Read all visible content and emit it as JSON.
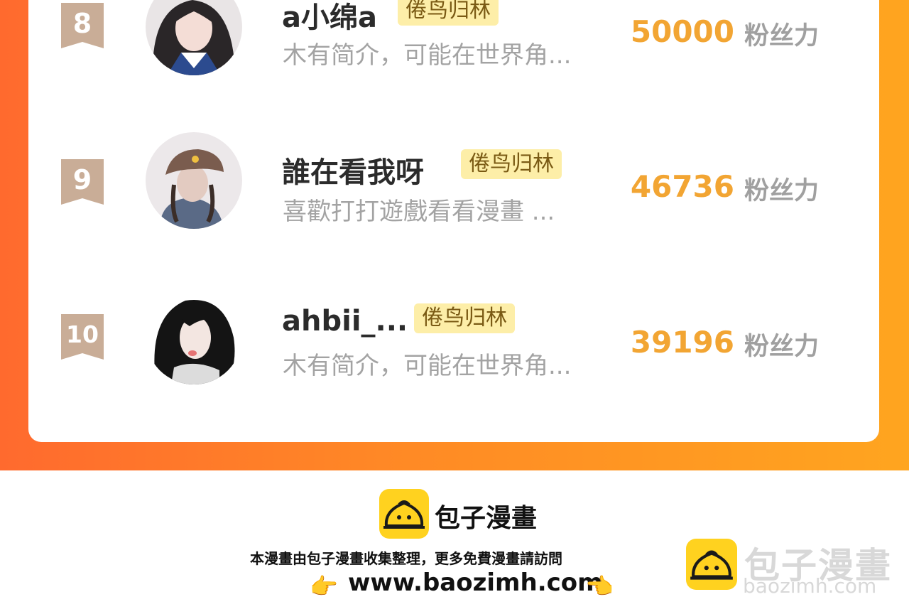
{
  "rows": [
    {
      "rank": "8",
      "name": "a小绵a",
      "tag": "倦鸟归林",
      "bio": "木有简介，可能在世界角...",
      "fans": "50000",
      "fans_label": "粉丝力"
    },
    {
      "rank": "9",
      "name": "誰在看我呀",
      "tag": "倦鸟归林",
      "bio": "喜歡打打遊戲看看漫畫 ...",
      "fans": "46736",
      "fans_label": "粉丝力"
    },
    {
      "rank": "10",
      "name": "ahbii_...",
      "tag": "倦鸟归林",
      "bio": "木有简介，可能在世界角...",
      "fans": "39196",
      "fans_label": "粉丝力"
    }
  ],
  "footer": {
    "brand": "包子漫畫",
    "note": "本漫畫由包子漫畫收集整理，更多免費漫畫請訪問",
    "url": "www.baozimh.com",
    "hand_left": "👉",
    "hand_right": "👈"
  },
  "watermark": {
    "brand": "包子漫畫",
    "url": "baozimh.com"
  },
  "colors": {
    "accent_orange": "#ff7a2a",
    "fans_number": "#f2a533",
    "tag_bg": "#fdeea8",
    "rank_badge": "#c9ad97",
    "logo_yellow": "#ffd21f"
  },
  "icons": {
    "logo": "steamed-bun-icon",
    "avatar_8": "user-avatar",
    "avatar_9": "user-avatar",
    "avatar_10": "user-avatar"
  }
}
